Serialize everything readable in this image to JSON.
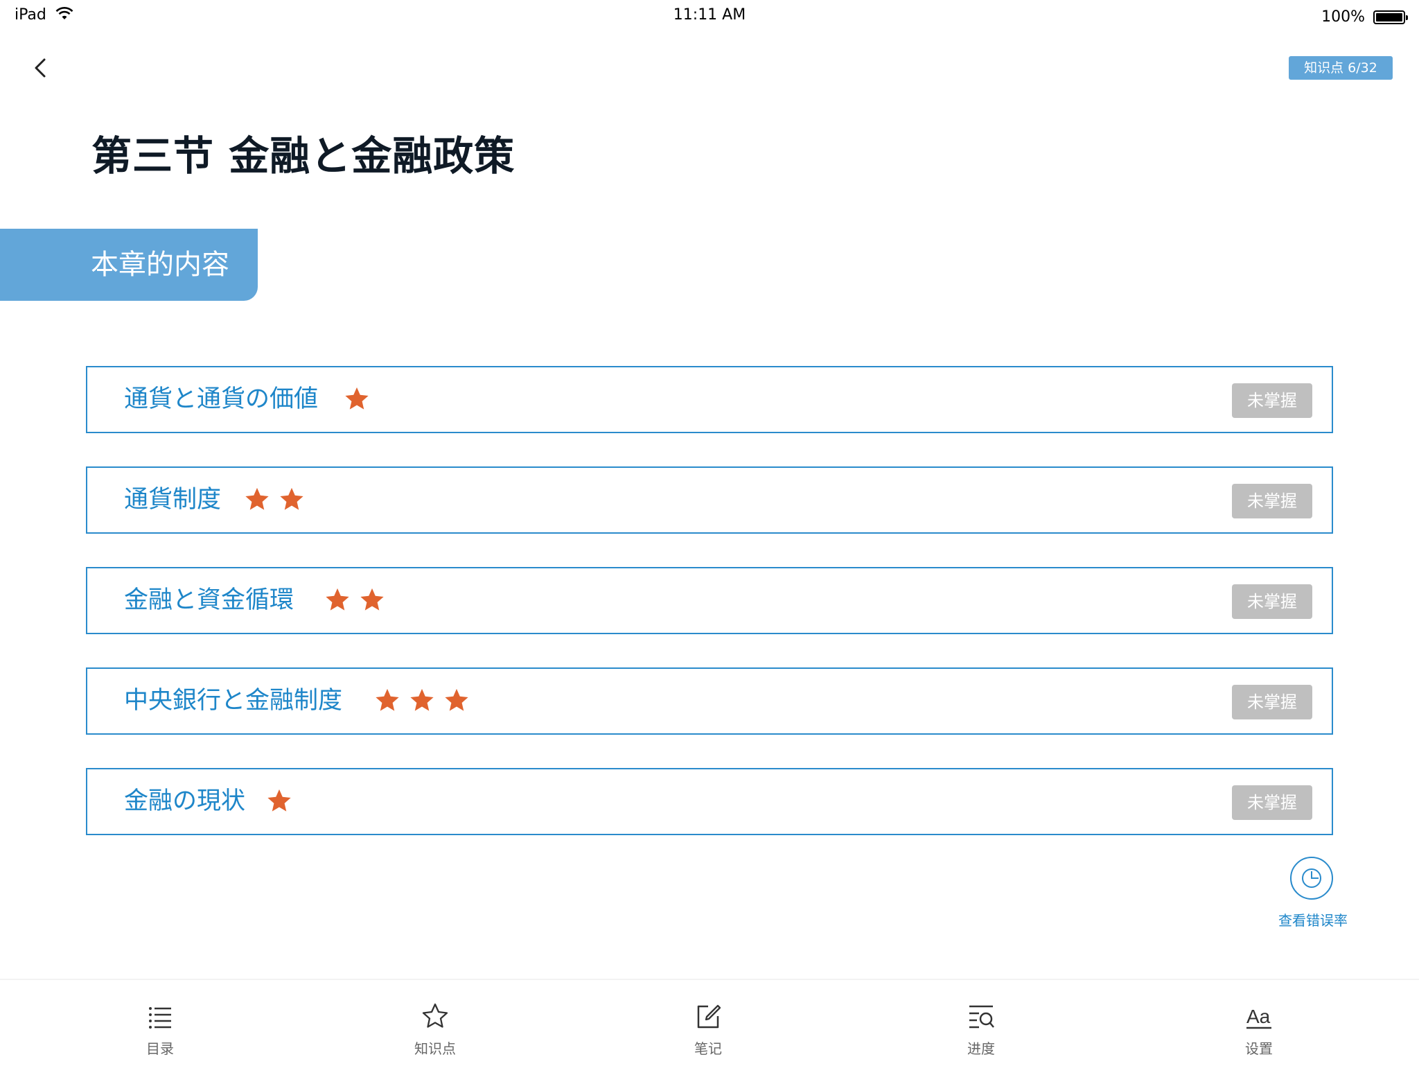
{
  "status_bar": {
    "device": "iPad",
    "time": "11:11 AM",
    "battery": "100%"
  },
  "header": {
    "knowledge_badge": "知识点 6/32",
    "title": "第三节 金融と金融政策"
  },
  "section": {
    "tab_label": "本章的内容"
  },
  "items": [
    {
      "label": "通貨と通貨の価値",
      "stars": 1,
      "status": "未掌握"
    },
    {
      "label": "通貨制度",
      "stars": 2,
      "status": "未掌握"
    },
    {
      "label": "金融と資金循環",
      "stars": 2,
      "status": "未掌握"
    },
    {
      "label": "中央銀行と金融制度",
      "stars": 3,
      "status": "未掌握"
    },
    {
      "label": "金融の現状",
      "stars": 1,
      "status": "未掌握"
    }
  ],
  "error_rate": {
    "label": "查看错误率"
  },
  "tabbar": {
    "items": [
      {
        "label": "目录",
        "icon": "list-icon"
      },
      {
        "label": "知识点",
        "icon": "star-outline-icon"
      },
      {
        "label": "笔记",
        "icon": "edit-note-icon"
      },
      {
        "label": "进度",
        "icon": "progress-search-icon"
      },
      {
        "label": "设置",
        "icon": "font-size-icon"
      }
    ]
  },
  "colors": {
    "accent": "#62a6d9",
    "link_blue": "#1e86c9",
    "star_orange": "#e0632e",
    "pill_gray": "#bfbfbf"
  }
}
